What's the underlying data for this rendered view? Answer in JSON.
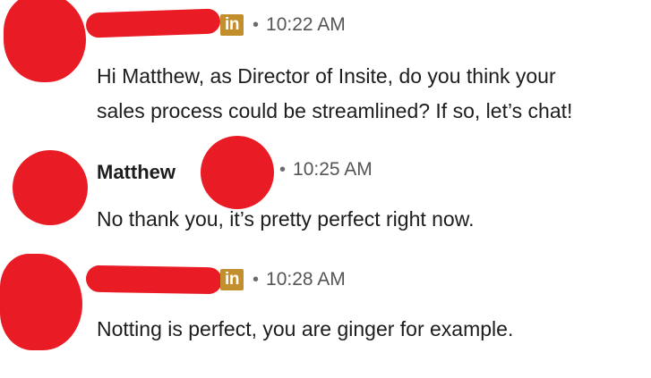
{
  "messages": [
    {
      "sender": "",
      "badge": "in",
      "time": "10:22 AM",
      "lines": [
        "Hi Matthew, as Director of Insite, do you think your",
        "sales process could be streamlined? If so, let’s chat!"
      ]
    },
    {
      "sender": "Matthew",
      "time": "10:25 AM",
      "lines": [
        "No thank you, it’s pretty perfect right now."
      ]
    },
    {
      "sender": "",
      "badge": "in",
      "time": "10:28 AM",
      "lines": [
        "Notting is perfect, you are ginger for example."
      ]
    }
  ],
  "separator": "•",
  "colors": {
    "redaction": "#e91c25",
    "linkedin_badge": "#c28f2c",
    "timestamp": "#555555"
  }
}
